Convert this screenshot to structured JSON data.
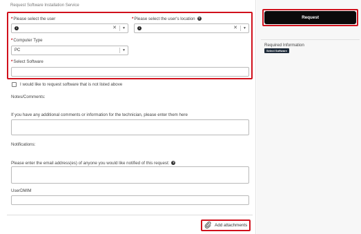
{
  "page": {
    "title": "Request Software Installation Service"
  },
  "form": {
    "user_label": "Please select the user",
    "location_label": "Please select the user's location",
    "computer_type_label": "Computer Type",
    "computer_type_value": "PC",
    "software_label": "Select Software",
    "not_listed_label": "I would like to request software that is not listed above",
    "notes_label": "Notes/Comments:",
    "notes_hint": "If you have any additional comments or information for the technician, please enter them here",
    "notifications_label": "Notifications:",
    "email_hint": "Please enter the email address(es) of anyone you would like notified of this request:",
    "userdmim_label": "UserDMIM"
  },
  "actions": {
    "attach_label": "Add attachments",
    "request_label": "Request"
  },
  "sidebar": {
    "required_info_label": "Required Information",
    "badge_label": "Select Software"
  },
  "colors": {
    "highlight": "#d0101b",
    "primary_button": "#0a0a0a",
    "badge": "#1e2b3a"
  }
}
